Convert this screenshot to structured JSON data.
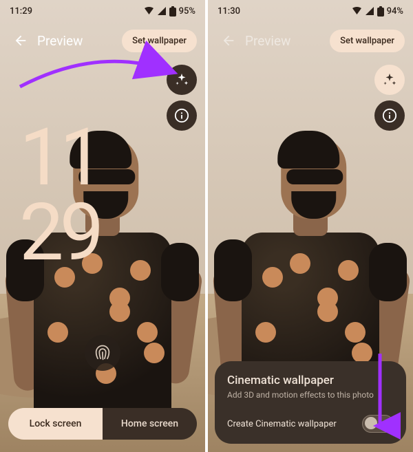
{
  "left": {
    "status": {
      "time": "11:29",
      "battery": "95%"
    },
    "appbar": {
      "title": "Preview",
      "set_wallpaper": "Set wallpaper"
    },
    "clock": {
      "hours": "11",
      "minutes": "29"
    },
    "tabs": {
      "lock": "Lock screen",
      "home": "Home screen"
    }
  },
  "right": {
    "status": {
      "time": "11:30",
      "battery": "94%"
    },
    "appbar": {
      "title": "Preview",
      "set_wallpaper": "Set wallpaper"
    },
    "sheet": {
      "title": "Cinematic wallpaper",
      "subtitle": "Add 3D and motion effects to this photo",
      "toggle_label": "Create Cinematic wallpaper",
      "toggle_on": false
    }
  },
  "icons": {
    "sparkle": "sparkle",
    "info": "info",
    "back": "back",
    "fingerprint": "fingerprint"
  }
}
